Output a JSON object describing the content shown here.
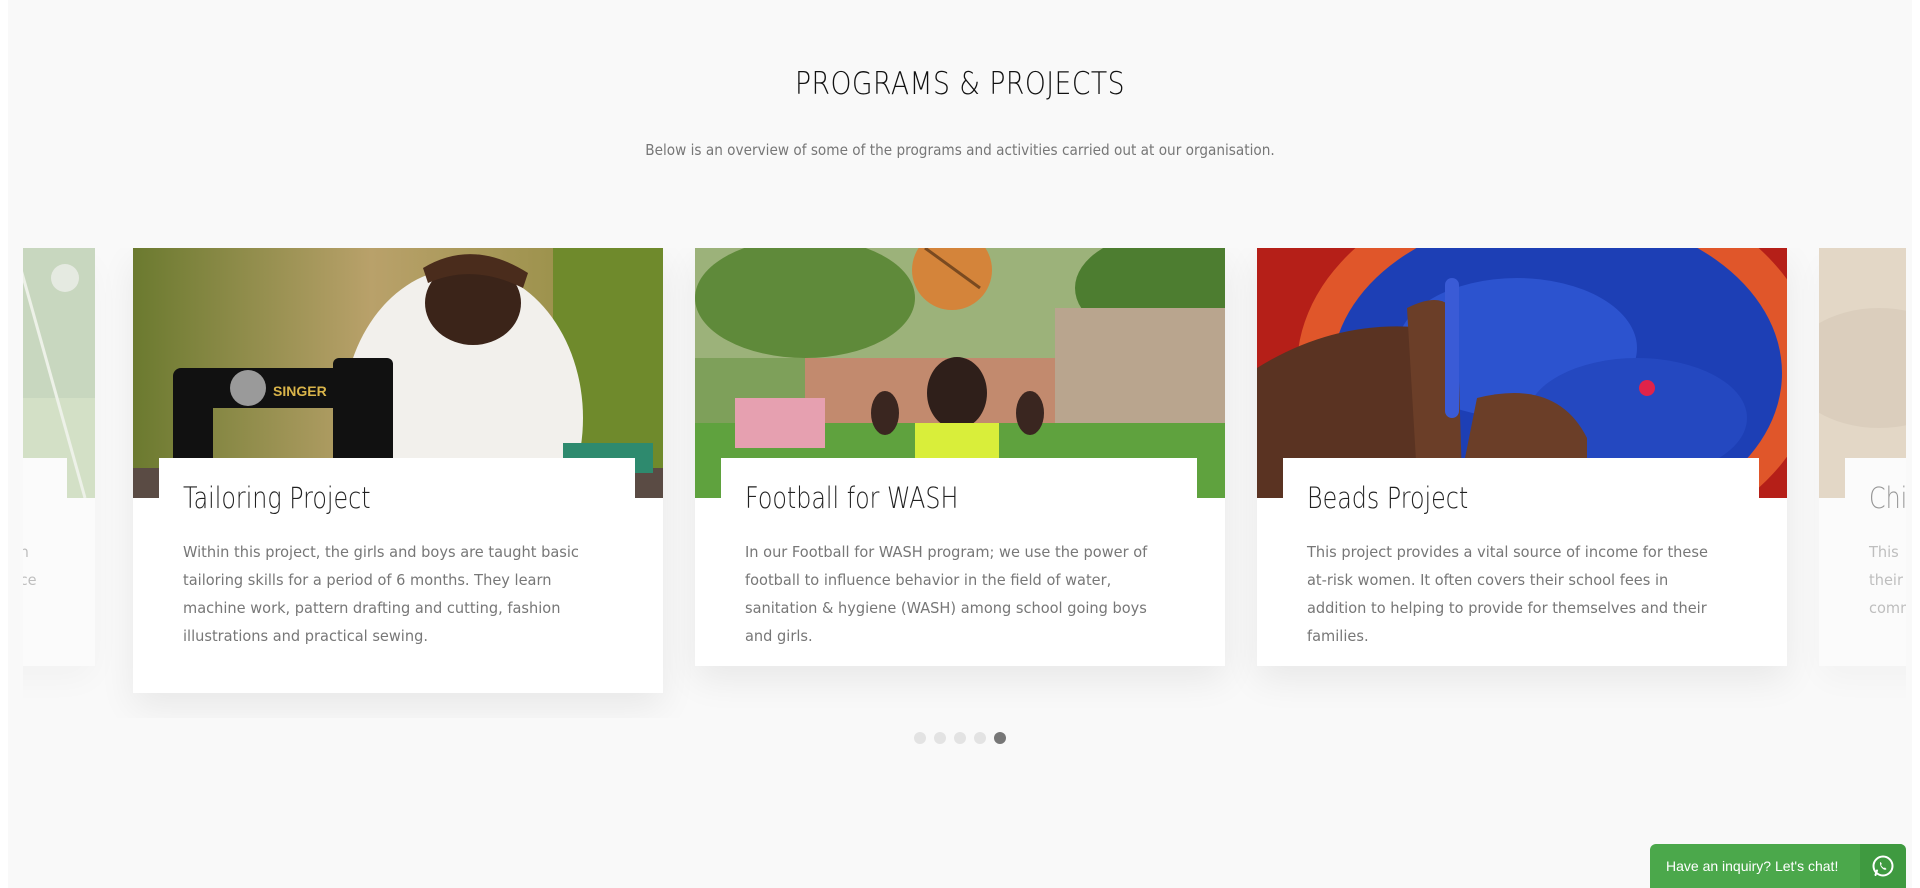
{
  "section": {
    "title": "PROGRAMS & PROJECTS",
    "subtitle": "Below is an overview of some of the programs and activities carried out at our organisation."
  },
  "cards": [
    {
      "title": "",
      "description": "…n\n…ce",
      "image": "sports-field-photo"
    },
    {
      "title": "Tailoring Project",
      "description": "Within this project, the girls and boys are taught basic tailoring skills for a period of 6 months. They learn machine work, pattern drafting and cutting, fashion illustrations and practical sewing.",
      "image": "woman-sewing-machine-photo"
    },
    {
      "title": "Football for WASH",
      "description": "In our Football for WASH program; we use the power of football to influence behavior in the field of water, sanitation & hygiene (WASH) among school going boys and girls.",
      "image": "boy-heading-football-photo"
    },
    {
      "title": "Beads Project",
      "description": "This project provides a vital source of income for these at-risk women. It often covers their school fees in addition to helping to provide for themselves and their families.",
      "image": "hands-blue-beads-photo"
    },
    {
      "title": "Chi",
      "description": "This\ntheir\ncomm",
      "image": "dry-ground-photo"
    }
  ],
  "pagination": {
    "count": 5,
    "active_index": 4
  },
  "chat": {
    "label": "Have an inquiry? Let's chat!",
    "icon": "whatsapp-icon",
    "color": "#4ba84b"
  }
}
